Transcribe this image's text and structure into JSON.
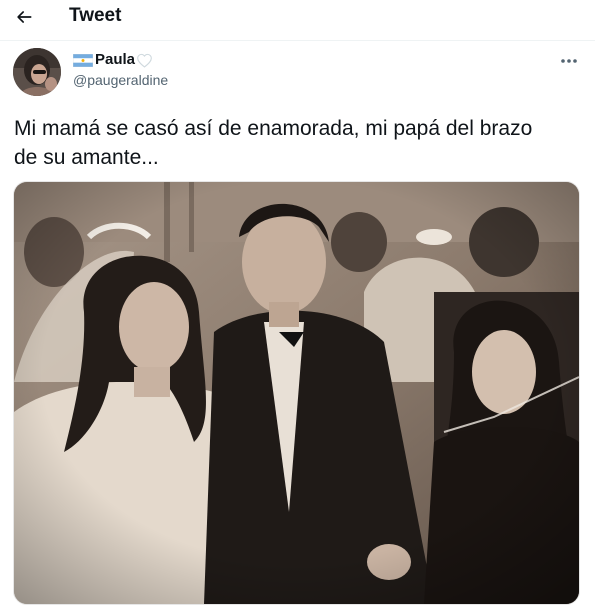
{
  "header": {
    "back_icon": "arrow-left-icon",
    "title": "Tweet"
  },
  "author": {
    "display_name": "Paula",
    "handle": "@paugeraldine",
    "flag_icon": "argentina-flag-icon",
    "heart_icon": "white-heart-icon",
    "avatar_icon": "user-avatar"
  },
  "more_icon": "more-horizontal-icon",
  "tweet": {
    "text": "Mi mamá se casó así de enamorada, mi papá del brazo\nde su amante..."
  },
  "media": {
    "type": "photo",
    "style": "sepia vintage wedding photograph"
  },
  "colors": {
    "text_primary": "#0f1419",
    "text_secondary": "#536471",
    "divider": "#eff3f4",
    "flag_blue": "#74acdf"
  }
}
